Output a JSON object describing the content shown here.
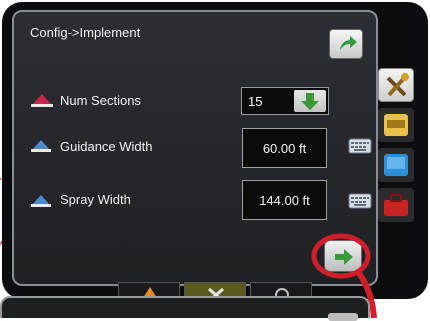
{
  "screen": {
    "title": "Config->Implement"
  },
  "rows": [
    {
      "label": "Num Sections",
      "value": "15"
    },
    {
      "label": "Guidance Width",
      "value": "60.00 ft"
    },
    {
      "label": "Spray Width",
      "value": "144.00 ft"
    }
  ],
  "side_tabs": [
    "tools-icon",
    "console-icon",
    "monitor-icon",
    "toolbox-icon"
  ],
  "bottom_tabs": [
    "warning-icon",
    "tools-icon",
    "info-icon"
  ],
  "colors": {
    "background": "#0d0d0f",
    "panel": "#25272b",
    "accent_green": "#3a9a3a",
    "highlight_red": "#d11f2a",
    "sections_icon_red": "#c8284a",
    "width_icon_blue": "#4d8bc8"
  }
}
